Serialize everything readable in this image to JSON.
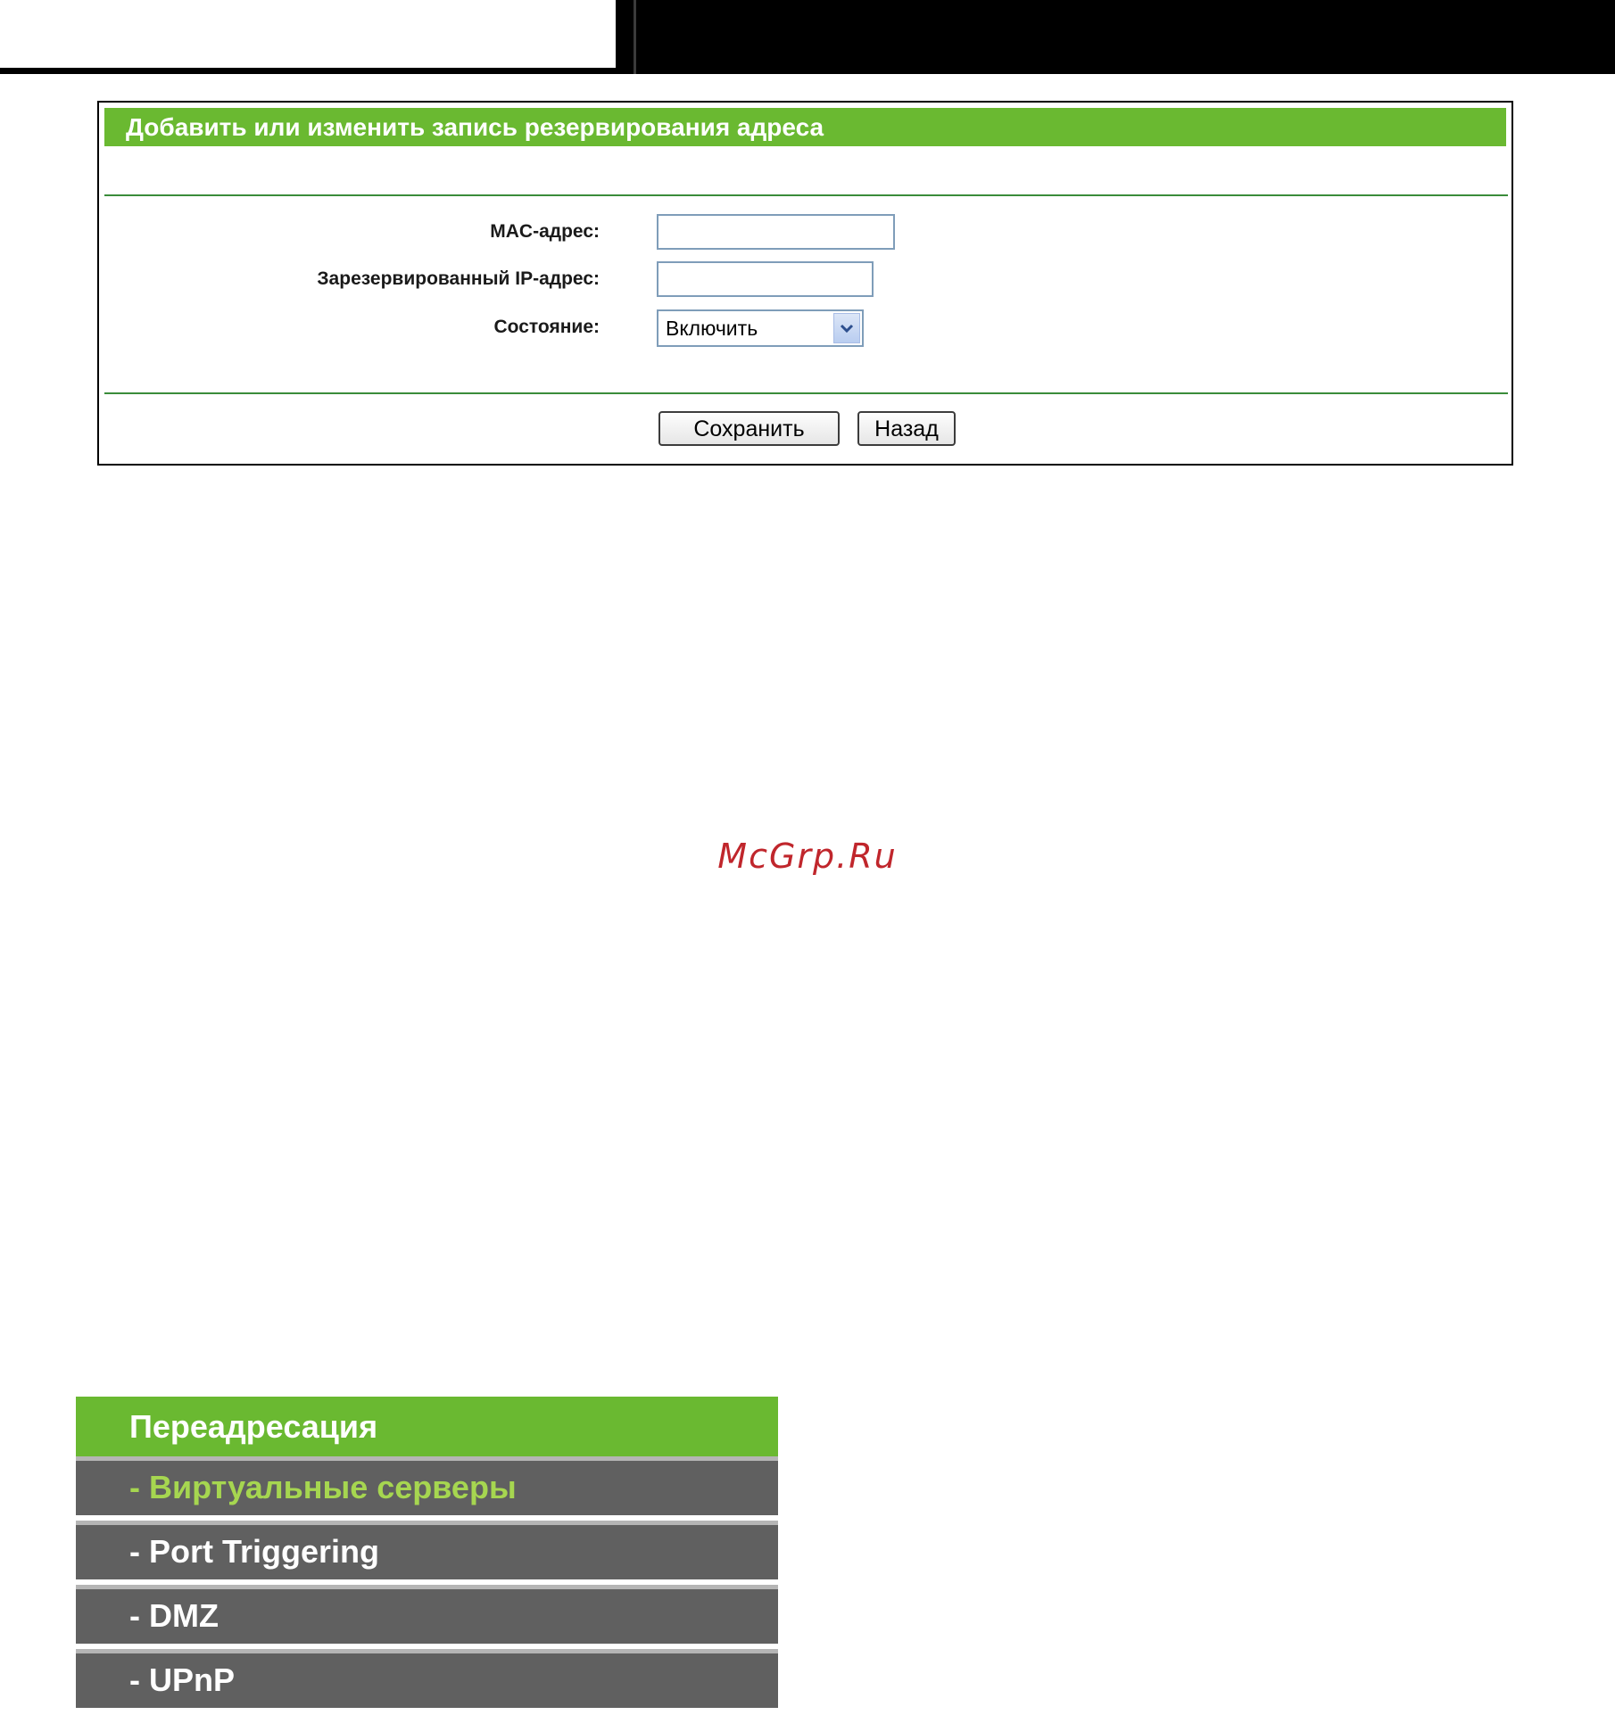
{
  "reservation_form": {
    "title": "Добавить или изменить запись резервирования адреса",
    "mac_label": "MAC-адрес:",
    "mac_value": "",
    "ip_label": "Зарезервированный IP-адрес:",
    "ip_value": "",
    "status_label": "Состояние:",
    "status_selected": "Включить",
    "save_label": "Сохранить",
    "back_label": "Назад"
  },
  "watermark": "McGrp.Ru",
  "forwarding_menu": {
    "header": "Переадресация",
    "items": [
      {
        "label": "- Виртуальные серверы",
        "active": true
      },
      {
        "label": "- Port Triggering",
        "active": false
      },
      {
        "label": "- DMZ",
        "active": false
      },
      {
        "label": "- UPnP",
        "active": false
      }
    ]
  },
  "colors": {
    "accent_green": "#6ab931",
    "menu_gray": "#606060",
    "active_item_text": "#a6d650",
    "watermark_red": "#c0262c"
  },
  "icons": {
    "select_arrow": "chevron-down-icon"
  }
}
